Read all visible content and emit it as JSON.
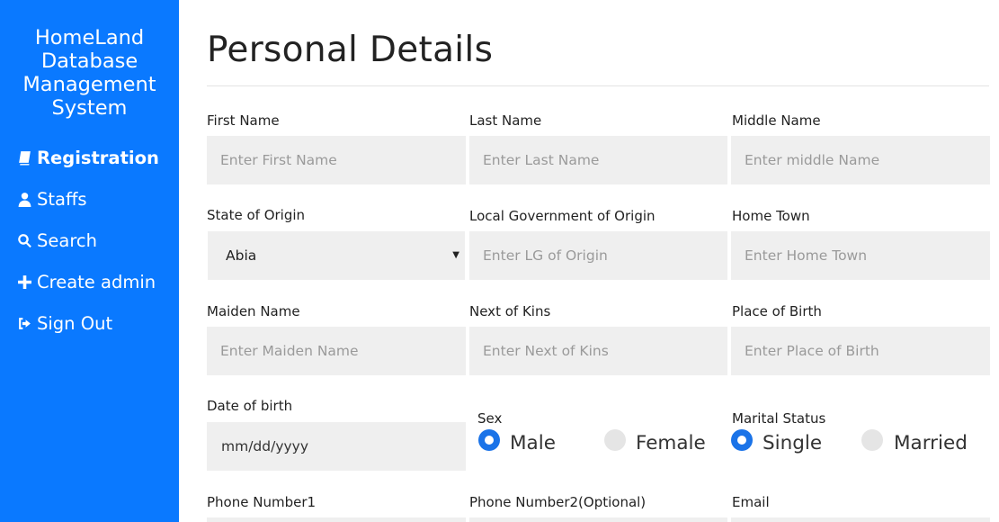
{
  "sidebar": {
    "brand": "HomeLand Database Management System",
    "items": [
      {
        "label": "Registration",
        "icon": "book-icon",
        "active": true
      },
      {
        "label": "Staffs",
        "icon": "user-icon",
        "active": false
      },
      {
        "label": "Search",
        "icon": "search-icon",
        "active": false
      },
      {
        "label": "Create admin",
        "icon": "plus-icon",
        "active": false
      },
      {
        "label": "Sign Out",
        "icon": "sign-out-icon",
        "active": false
      }
    ],
    "background_color": "#0a79ff"
  },
  "main": {
    "title": "Personal Details",
    "fields": {
      "first_name": {
        "label": "First Name",
        "placeholder": "Enter First Name"
      },
      "last_name": {
        "label": "Last Name",
        "placeholder": "Enter Last Name"
      },
      "middle_name": {
        "label": "Middle Name",
        "placeholder": "Enter middle Name"
      },
      "state_of_origin": {
        "label": "State of Origin",
        "value": "Abia"
      },
      "lg_of_origin": {
        "label": "Local Government of Origin",
        "placeholder": "Enter LG of Origin"
      },
      "home_town": {
        "label": "Home Town",
        "placeholder": "Enter Home Town"
      },
      "maiden_name": {
        "label": "Maiden Name",
        "placeholder": "Enter Maiden Name"
      },
      "next_of_kins": {
        "label": "Next of Kins",
        "placeholder": "Enter Next of Kins"
      },
      "place_of_birth": {
        "label": "Place of Birth",
        "placeholder": "Enter Place of Birth"
      },
      "date_of_birth": {
        "label": "Date of birth",
        "placeholder": "mm/dd/yyyy"
      },
      "sex": {
        "label": "Sex",
        "options": [
          "Male",
          "Female"
        ],
        "selected": "Male"
      },
      "marital_status": {
        "label": "Marital Status",
        "options": [
          "Single",
          "Married"
        ],
        "selected": "Single"
      },
      "phone1": {
        "label": "Phone Number1"
      },
      "phone2": {
        "label": "Phone Number2(Optional)"
      },
      "email": {
        "label": "Email"
      }
    },
    "accent_color": "#1a73e8"
  }
}
